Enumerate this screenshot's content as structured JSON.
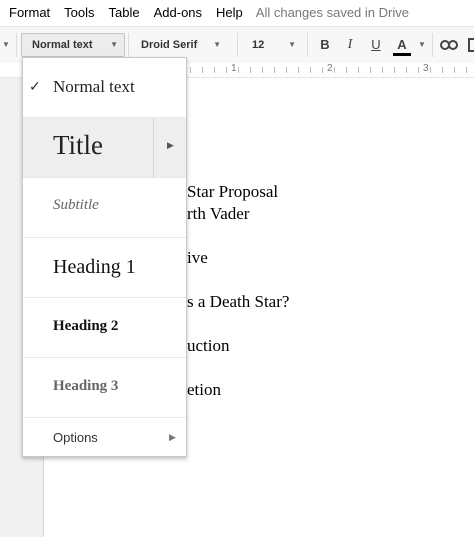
{
  "menubar": {
    "items": [
      "Format",
      "Tools",
      "Table",
      "Add-ons",
      "Help"
    ],
    "status": "All changes saved in Drive"
  },
  "toolbar": {
    "style_value": "Normal text",
    "font_value": "Droid Serif",
    "size_value": "12",
    "bold_label": "B",
    "italic_label": "I",
    "underline_label": "U",
    "text_color_label": "A",
    "text_color": "#000000"
  },
  "ruler": {
    "numbers": [
      "1",
      "2",
      "3"
    ]
  },
  "document": {
    "lines": [
      "Star Proposal",
      "rth Vader",
      "ive",
      "s a Death Star?",
      "uction",
      "etion"
    ]
  },
  "style_menu": {
    "selected": "Normal text",
    "items": {
      "normal": "Normal text",
      "title": "Title",
      "subtitle": "Subtitle",
      "heading1": "Heading 1",
      "heading2": "Heading 2",
      "heading3": "Heading 3",
      "options": "Options"
    }
  },
  "icons": {
    "check": "check-icon",
    "submenu": "submenu-arrow-icon",
    "link": "link-icon",
    "caret": "chevron-down-icon"
  }
}
